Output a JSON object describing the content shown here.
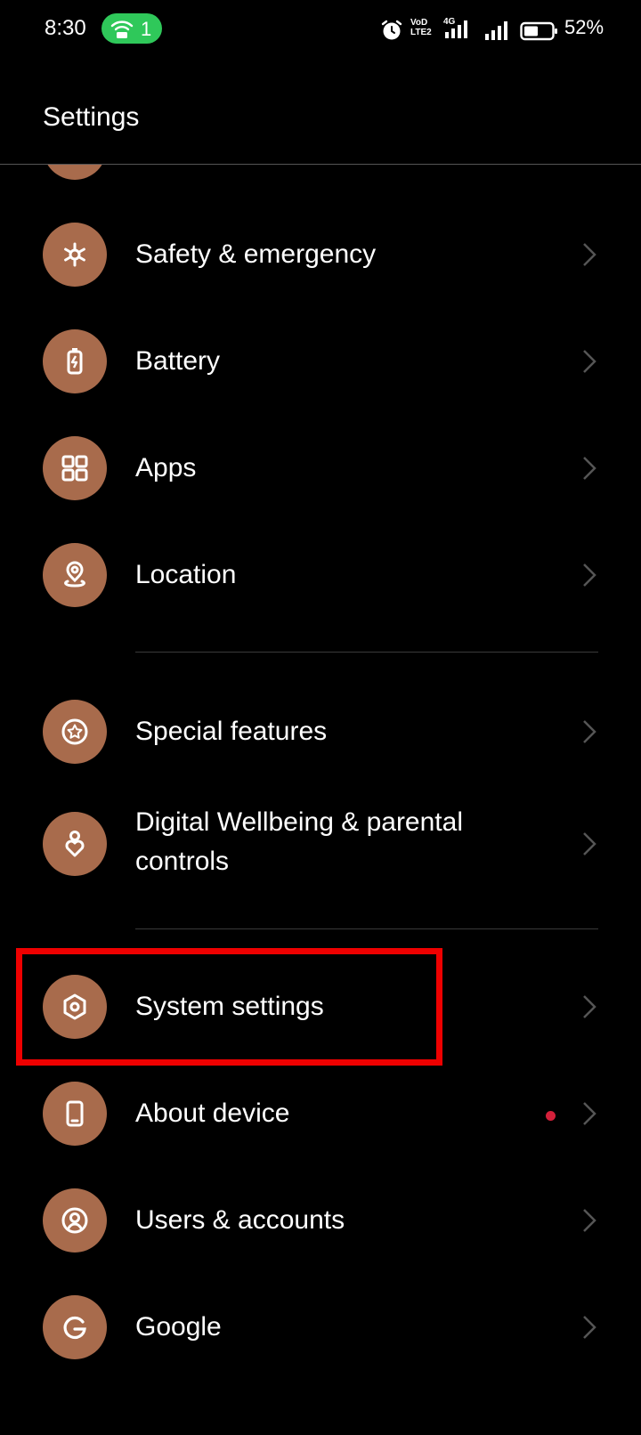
{
  "status_bar": {
    "time": "8:30",
    "hotspot_count": "1",
    "volte_label": "VoD LTE2",
    "network_label": "4G",
    "battery_percent": "52%",
    "icons": [
      "alarm-icon",
      "volte-icon",
      "signal-4g-icon",
      "signal-icon",
      "battery-icon"
    ],
    "battery_level": 0.52
  },
  "header": {
    "title": "Settings"
  },
  "colors": {
    "icon_background": "#a86b4c",
    "highlight": "#ee0000",
    "notification_dot": "#d3203a",
    "hotspot_pill": "#2fc85a"
  },
  "sections": [
    {
      "items": [
        {
          "label": "Safety & emergency",
          "icon": "asterisk-icon"
        },
        {
          "label": "Battery",
          "icon": "battery-charging-icon"
        },
        {
          "label": "Apps",
          "icon": "apps-grid-icon"
        },
        {
          "label": "Location",
          "icon": "location-pin-icon"
        }
      ]
    },
    {
      "items": [
        {
          "label": "Special features",
          "icon": "star-circle-icon"
        },
        {
          "label": "Digital Wellbeing & parental controls",
          "icon": "wellbeing-heart-icon"
        }
      ]
    },
    {
      "items": [
        {
          "label": "System settings",
          "icon": "hexagon-gear-icon",
          "highlighted": true
        },
        {
          "label": "About device",
          "icon": "phone-device-icon",
          "has_notification": true
        },
        {
          "label": "Users & accounts",
          "icon": "user-circle-icon"
        },
        {
          "label": "Google",
          "icon": "google-g-icon"
        }
      ]
    }
  ]
}
